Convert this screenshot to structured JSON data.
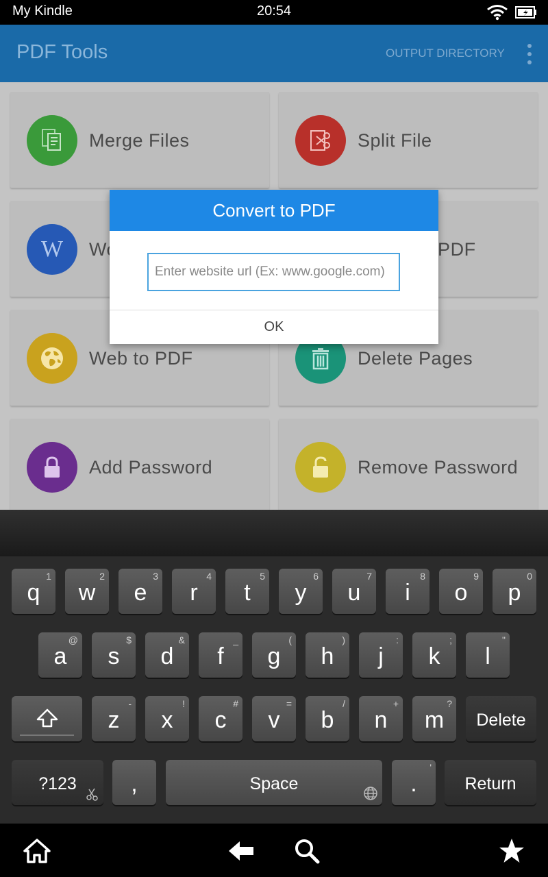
{
  "status_bar": {
    "carrier": "My Kindle",
    "time": "20:54"
  },
  "app_bar": {
    "title": "PDF Tools",
    "output_directory": "OUTPUT DIRECTORY"
  },
  "tools": [
    {
      "label": "Merge Files",
      "color": "#3a9a3a",
      "icon": "merge-files-icon"
    },
    {
      "label": "Split File",
      "color": "#b8302a",
      "icon": "scissors-icon"
    },
    {
      "label": "Word to PDF",
      "color": "#2659b5",
      "icon": "word-icon"
    },
    {
      "label": "Image to PDF",
      "color": "#c9a21e",
      "icon": "image-icon"
    },
    {
      "label": "Web to PDF",
      "color": "#c9a21e",
      "icon": "globe-icon"
    },
    {
      "label": "Delete Pages",
      "color": "#1a9378",
      "icon": "trash-icon"
    },
    {
      "label": "Add Password",
      "color": "#6a2d8e",
      "icon": "lock-icon"
    },
    {
      "label": "Remove Password",
      "color": "#c4b22a",
      "icon": "unlock-icon"
    }
  ],
  "word_glyph": "W",
  "dialog": {
    "title": "Convert to PDF",
    "input_placeholder": "Enter website url (Ex: www.google.com)",
    "input_value": "",
    "ok_label": "OK"
  },
  "keyboard": {
    "row1": [
      {
        "k": "q",
        "s": "1"
      },
      {
        "k": "w",
        "s": "2"
      },
      {
        "k": "e",
        "s": "3"
      },
      {
        "k": "r",
        "s": "4"
      },
      {
        "k": "t",
        "s": "5"
      },
      {
        "k": "y",
        "s": "6"
      },
      {
        "k": "u",
        "s": "7"
      },
      {
        "k": "i",
        "s": "8"
      },
      {
        "k": "o",
        "s": "9"
      },
      {
        "k": "p",
        "s": "0"
      }
    ],
    "row2": [
      {
        "k": "a",
        "s": "@"
      },
      {
        "k": "s",
        "s": "$"
      },
      {
        "k": "d",
        "s": "&"
      },
      {
        "k": "f",
        "s": "_"
      },
      {
        "k": "g",
        "s": "("
      },
      {
        "k": "h",
        "s": ")"
      },
      {
        "k": "j",
        "s": ":"
      },
      {
        "k": "k",
        "s": ";"
      },
      {
        "k": "l",
        "s": "\""
      }
    ],
    "row3": [
      {
        "k": "z",
        "s": "-"
      },
      {
        "k": "x",
        "s": "!"
      },
      {
        "k": "c",
        "s": "#"
      },
      {
        "k": "v",
        "s": "="
      },
      {
        "k": "b",
        "s": "/"
      },
      {
        "k": "n",
        "s": "+"
      },
      {
        "k": "m",
        "s": "?"
      }
    ],
    "delete_label": "Delete",
    "symbols_label": "?123",
    "comma_label": ",",
    "space_label": "Space",
    "period_label": ".",
    "period_secondary": "'",
    "return_label": "Return"
  }
}
